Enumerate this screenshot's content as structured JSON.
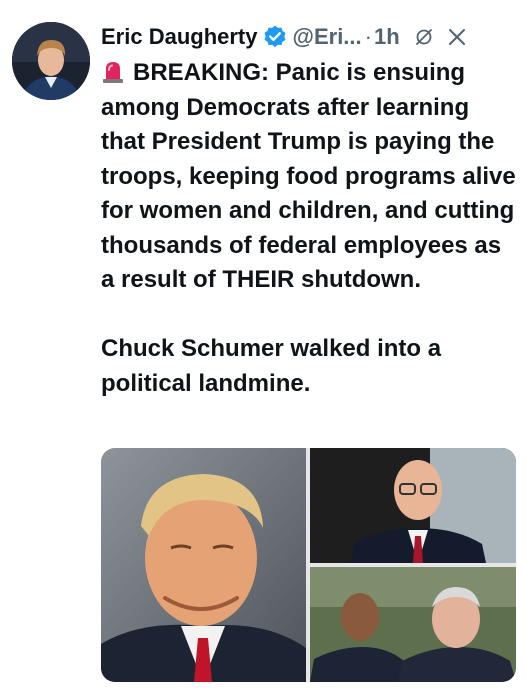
{
  "author": {
    "name": "Eric Daugherty",
    "handle": "@Eri...",
    "separator": "·",
    "time": "1h",
    "verified_color": "#1d9bf0"
  },
  "icons": {
    "verified": "verified-badge-icon",
    "grok": "grok-icon",
    "close": "close-icon",
    "siren": "police-siren-icon"
  },
  "tweet": {
    "paragraph_1": "BREAKING: Panic is ensuing among Democrats after learning that President Trump is paying the troops, keeping food programs alive for women and children, and cutting thousands of federal employees as a result of THEIR shutdown.",
    "paragraph_2": "Chuck Schumer walked into a political landmine."
  },
  "media": {
    "count": 3
  }
}
